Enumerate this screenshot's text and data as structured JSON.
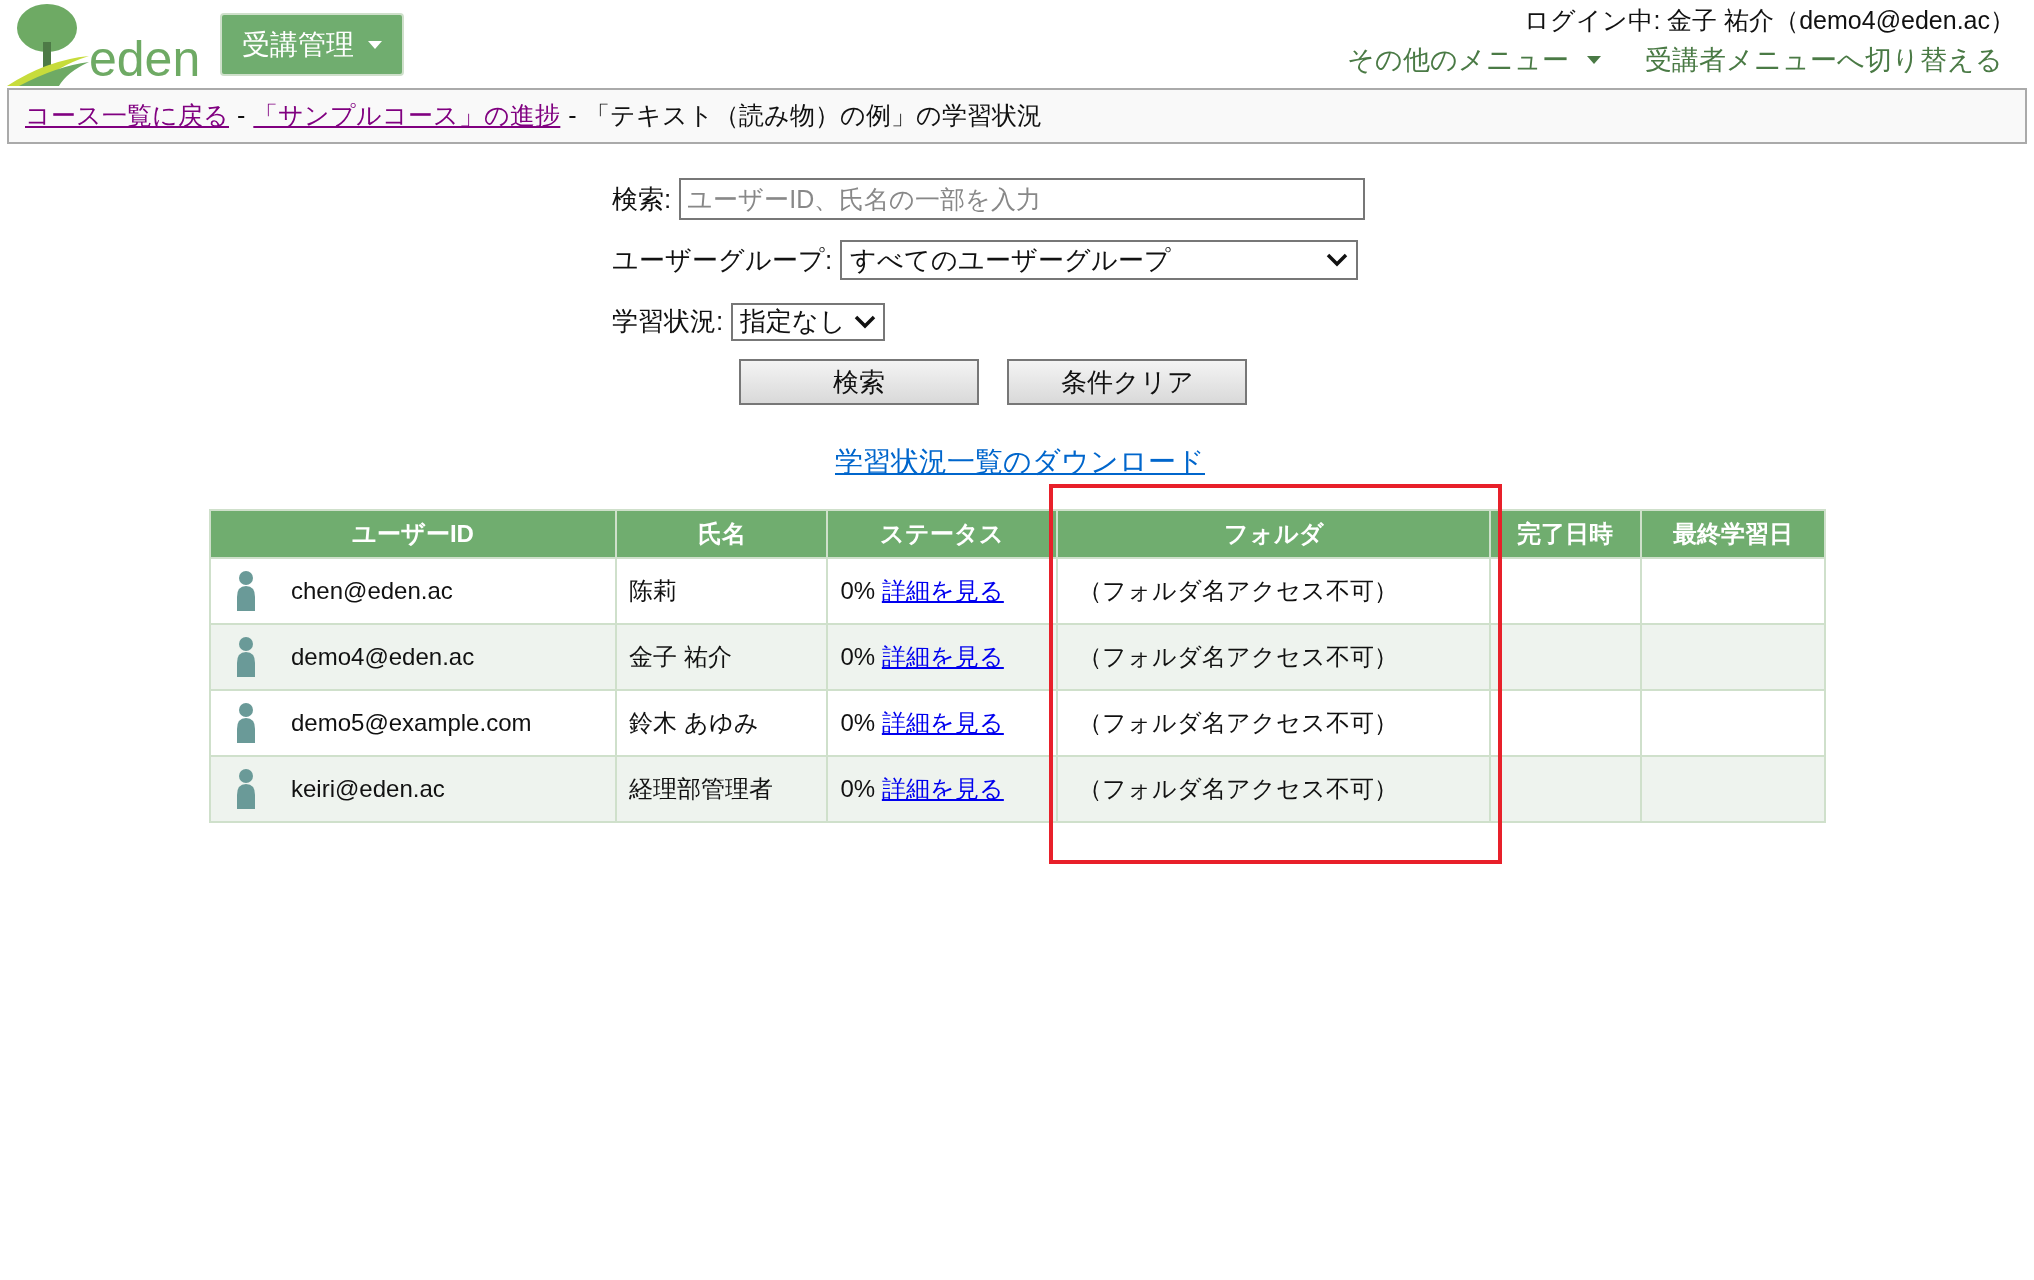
{
  "header": {
    "logo_text": "eden",
    "menu_button": "受講管理",
    "login_info": "ログイン中: 金子 祐介（demo4@eden.ac）",
    "other_menu": "その他のメニュー",
    "switch_link": "受講者メニューへ切り替える"
  },
  "breadcrumb": [
    {
      "kind": "link",
      "text": "コース一覧に戻る"
    },
    {
      "kind": "sep",
      "text": "-"
    },
    {
      "kind": "link",
      "text": "「サンプルコース」の進捗"
    },
    {
      "kind": "sep",
      "text": "-"
    },
    {
      "kind": "text",
      "text": "「テキスト（読み物）の例」の学習状況"
    }
  ],
  "search": {
    "label": "検索:",
    "placeholder": "ユーザーID、氏名の一部を入力"
  },
  "group_filter": {
    "label": "ユーザーグループ:",
    "value": "すべてのユーザーグループ"
  },
  "status_filter": {
    "label": "学習状況:",
    "value": "指定なし"
  },
  "buttons": [
    "検索",
    "条件クリア"
  ],
  "download_link": "学習状況一覧のダウンロード",
  "table": {
    "columns": [
      "ユーザーID",
      "氏名",
      "ステータス",
      "フォルダ",
      "完了日時",
      "最終学習日"
    ],
    "rows": [
      {
        "user_id": "chen@eden.ac",
        "name": "陈莉",
        "progress": "0%",
        "detail": "詳細を見る",
        "folder": "（フォルダ名アクセス不可）"
      },
      {
        "user_id": "demo4@eden.ac",
        "name": "金子 祐介",
        "progress": "0%",
        "detail": "詳細を見る",
        "folder": "（フォルダ名アクセス不可）"
      },
      {
        "user_id": "demo5@example.com",
        "name": "鈴木 あゆみ",
        "progress": "0%",
        "detail": "詳細を見る",
        "folder": "（フォルダ名アクセス不可）"
      },
      {
        "user_id": "keiri@eden.ac",
        "name": "経理部管理者",
        "progress": "0%",
        "detail": "詳細を見る",
        "folder": "（フォルダ名アクセス不可）"
      }
    ]
  }
}
